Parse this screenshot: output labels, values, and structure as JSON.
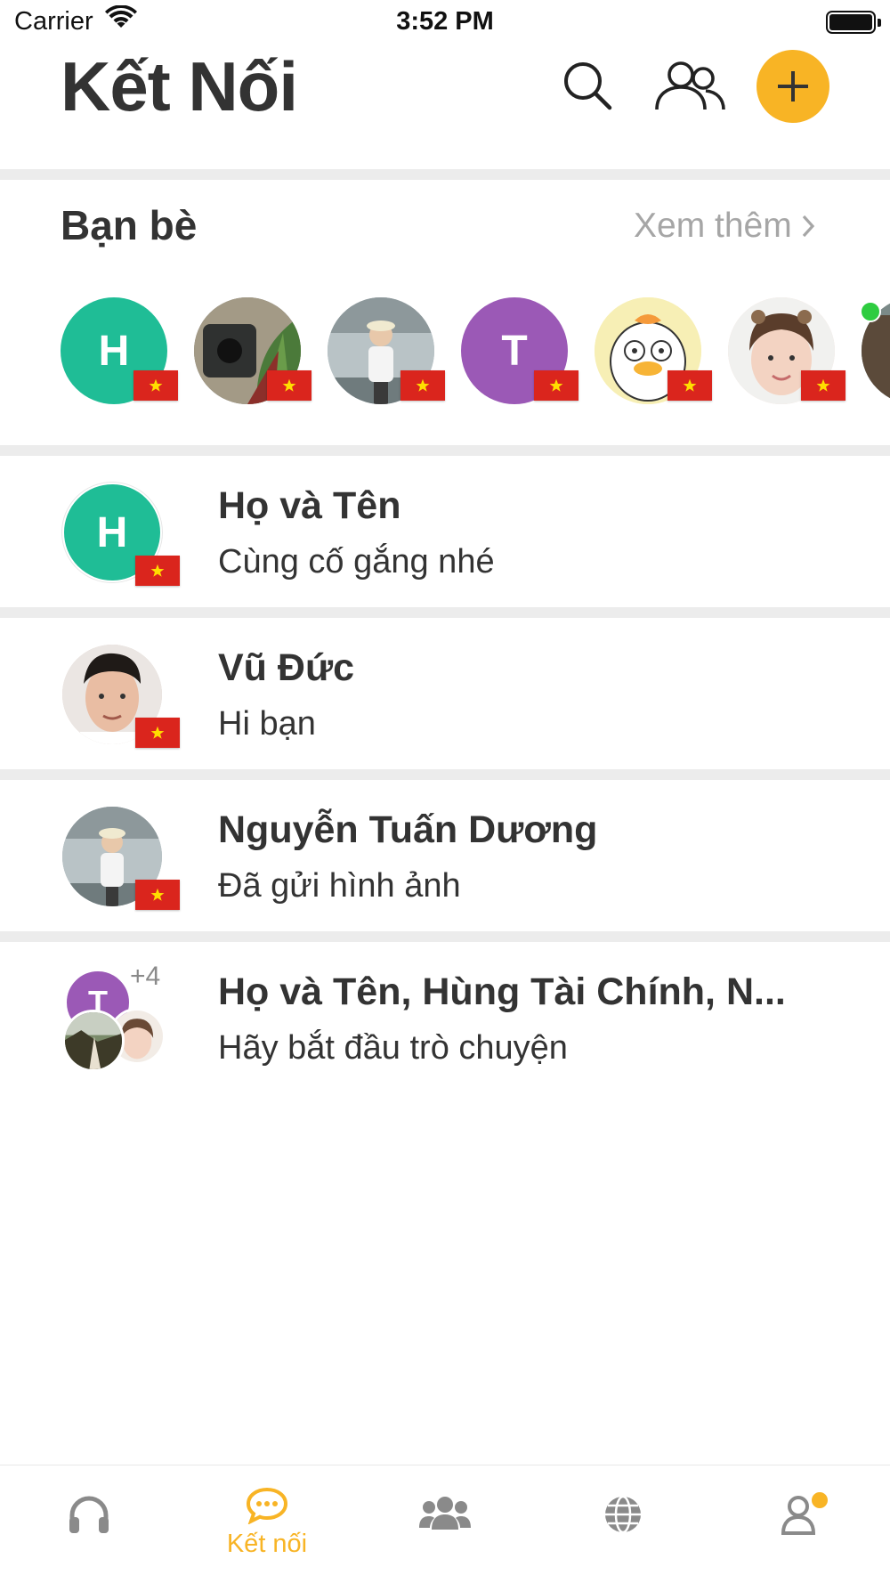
{
  "status_bar": {
    "carrier": "Carrier",
    "time": "3:52 PM"
  },
  "header": {
    "title": "Kết Nối"
  },
  "friends": {
    "title": "Bạn bè",
    "see_more": "Xem thêm",
    "items": [
      {
        "initial": "H",
        "color": "#1fbd96"
      },
      {
        "initial": "",
        "color": "#6b6a5e"
      },
      {
        "initial": "",
        "color": "#9aa7ad"
      },
      {
        "initial": "T",
        "color": "#9b59b6"
      },
      {
        "initial": "",
        "color": "#f7efb5"
      },
      {
        "initial": "",
        "color": "#f3d6cc"
      },
      {
        "initial": "",
        "color": "#7b8a88"
      }
    ]
  },
  "conversations": [
    {
      "name": "Họ và Tên",
      "message": "Cùng cố gắng nhé",
      "initial": "H",
      "color": "#1fbd96"
    },
    {
      "name": "Vũ Đức",
      "message": "Hi bạn",
      "initial": "",
      "color": "#d9c8bd"
    },
    {
      "name": "Nguyễn Tuấn Dương",
      "message": "Đã gửi hình ảnh",
      "initial": "",
      "color": "#9aa7ad"
    },
    {
      "name": "Họ và Tên, Hùng Tài Chính, N...",
      "message": "Hãy bắt đầu trò chuyện",
      "initial": "T",
      "color": "#9b59b6",
      "extra_count": "+4"
    }
  ],
  "tabbar": {
    "active_label": "Kết nối",
    "accent": "#f8b425",
    "inactive": "#8a8a8a"
  }
}
